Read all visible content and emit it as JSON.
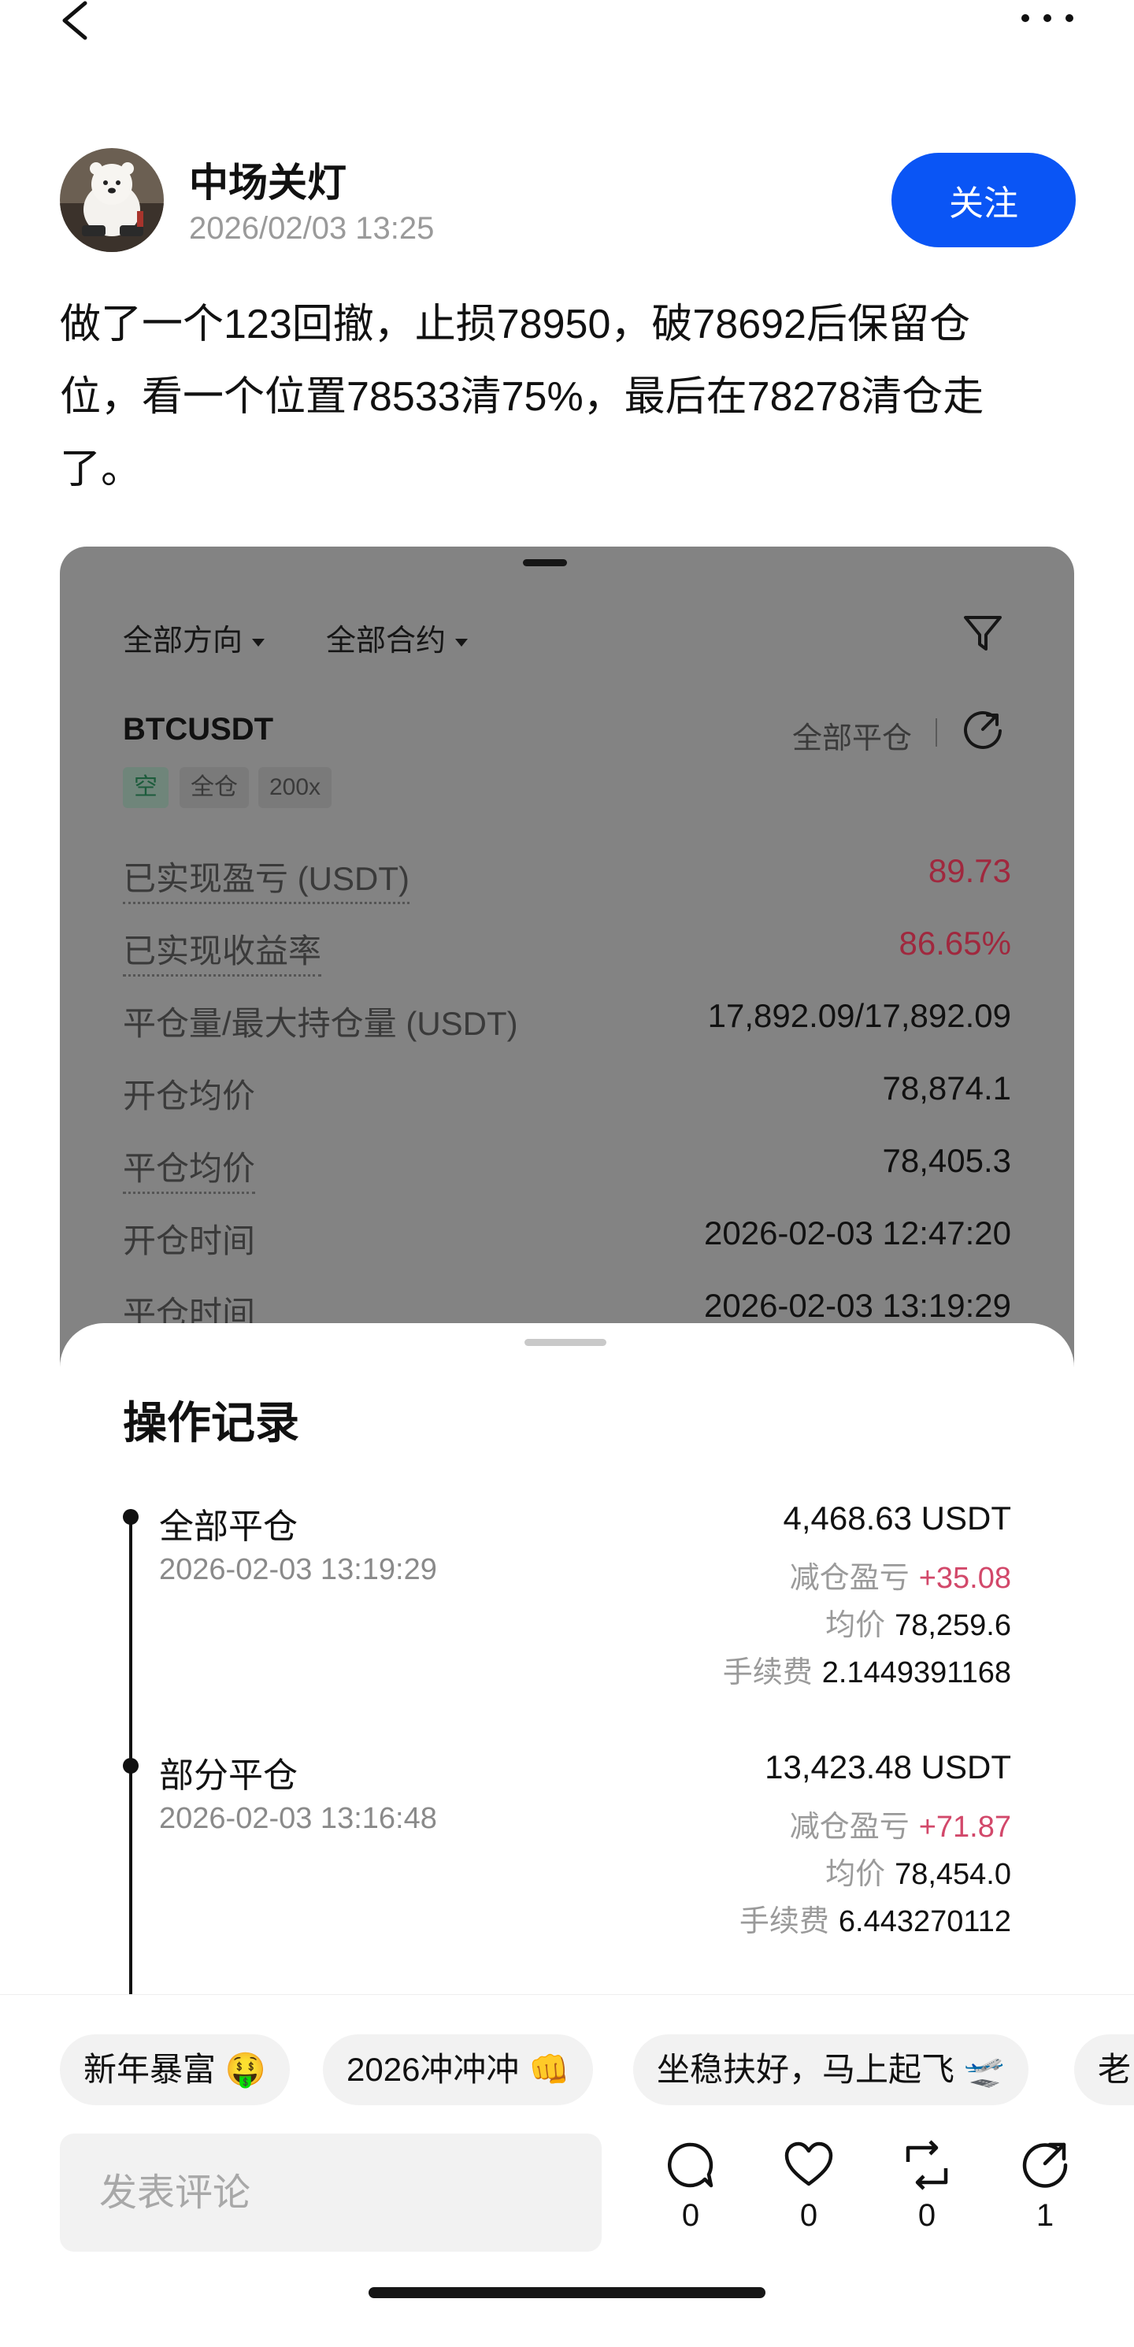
{
  "topbar": {
    "back_icon": "chevron-left-icon",
    "more_icon": "more-dots-icon"
  },
  "author": {
    "name": "中场关灯",
    "time": "2026/02/03 13:25",
    "follow_label": "关注",
    "colors": {
      "follow_bg": "#0a55f5"
    }
  },
  "post": {
    "lines": [
      "做了一个123回撤，止损78950，破78692后保留仓",
      "位，看一个位置78533清75%，最后在78278清仓走",
      "了。"
    ]
  },
  "position_card": {
    "filters": [
      "全部方向",
      "全部合约"
    ],
    "filter_icon": "funnel-icon",
    "symbol": "BTCUSDT",
    "close_all_label": "全部平仓",
    "share_icon": "share-icon",
    "tags": [
      "空",
      "全仓",
      "200x"
    ],
    "rows": [
      {
        "label": "已实现盈亏 (USDT)",
        "value": "89.73"
      },
      {
        "label": "已实现收益率",
        "value": "86.65%"
      },
      {
        "label": "平仓量/最大持仓量 (USDT)",
        "value": "17,892.09/17,892.09"
      },
      {
        "label": "开仓均价",
        "value": "78,874.1"
      },
      {
        "label": "平仓均价",
        "value": "78,405.3"
      },
      {
        "label": "开仓时间",
        "value": "2026-02-03 12:47:20"
      },
      {
        "label": "平仓时间",
        "value": "2026-02-03 13:19:29"
      }
    ],
    "colors": {
      "positive": "#a0283e",
      "short_tag": "#1d5c3c"
    }
  },
  "records": {
    "title": "操作记录",
    "items": [
      {
        "title": "全部平仓",
        "time": "2026-02-03 13:19:29",
        "amount": "4,468.63 USDT",
        "pnl_label": "减仓盈亏",
        "pnl_value": "+35.08",
        "price_label": "均价",
        "price_value": "78,259.6",
        "fee_label": "手续费",
        "fee_value": "2.1449391168"
      },
      {
        "title": "部分平仓",
        "time": "2026-02-03 13:16:48",
        "amount": "13,423.48 USDT",
        "pnl_label": "减仓盈亏",
        "pnl_value": "+71.87",
        "price_label": "均价",
        "price_value": "78,454.0",
        "fee_label": "手续费",
        "fee_value": "6.443270112"
      }
    ],
    "colors": {
      "pnl": "#d2486a"
    }
  },
  "chips": [
    "新年暴富 🤑",
    "2026冲冲冲 👊",
    "坐稳扶好，马上起飞 🛫",
    "老"
  ],
  "comment": {
    "placeholder": "发表评论"
  },
  "actions": [
    {
      "icon": "comment-icon",
      "count": "0"
    },
    {
      "icon": "heart-icon",
      "count": "0"
    },
    {
      "icon": "repost-icon",
      "count": "0"
    },
    {
      "icon": "share-icon",
      "count": "1"
    }
  ]
}
